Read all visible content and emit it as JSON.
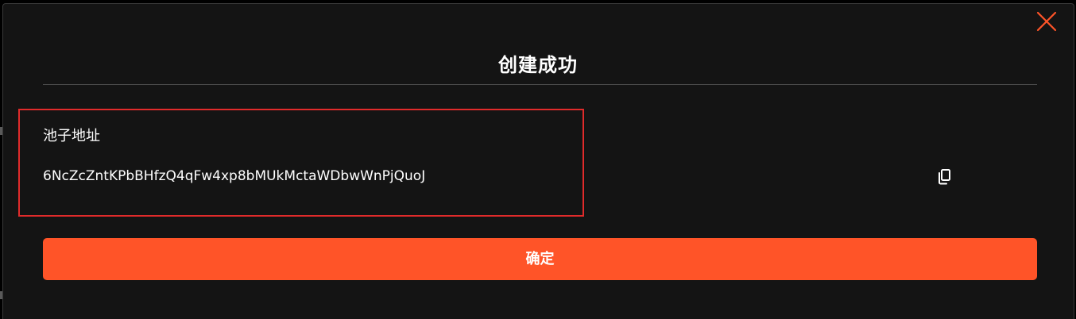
{
  "modal": {
    "title": "创建成功",
    "field_label": "池子地址",
    "address": "6NcZcZntKPbBHfzQ4qFw4xp8bMUkMctaWDbwWnPjQuoJ",
    "confirm_label": "确定",
    "close_icon": "close-icon",
    "copy_icon": "copy-icon"
  },
  "colors": {
    "accent": "#ff5428",
    "highlight": "#e02b2b",
    "background": "#141414",
    "text": "#ffffff"
  }
}
